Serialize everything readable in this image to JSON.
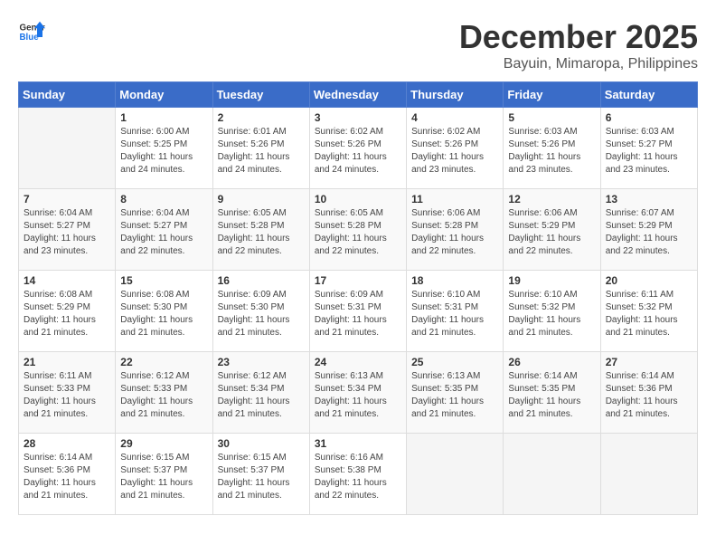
{
  "header": {
    "logo_general": "General",
    "logo_blue": "Blue",
    "month_year": "December 2025",
    "location": "Bayuin, Mimaropa, Philippines"
  },
  "weekdays": [
    "Sunday",
    "Monday",
    "Tuesday",
    "Wednesday",
    "Thursday",
    "Friday",
    "Saturday"
  ],
  "weeks": [
    [
      {
        "day": "",
        "sunrise": "",
        "sunset": "",
        "daylight": ""
      },
      {
        "day": "1",
        "sunrise": "Sunrise: 6:00 AM",
        "sunset": "Sunset: 5:25 PM",
        "daylight": "Daylight: 11 hours and 24 minutes."
      },
      {
        "day": "2",
        "sunrise": "Sunrise: 6:01 AM",
        "sunset": "Sunset: 5:26 PM",
        "daylight": "Daylight: 11 hours and 24 minutes."
      },
      {
        "day": "3",
        "sunrise": "Sunrise: 6:02 AM",
        "sunset": "Sunset: 5:26 PM",
        "daylight": "Daylight: 11 hours and 24 minutes."
      },
      {
        "day": "4",
        "sunrise": "Sunrise: 6:02 AM",
        "sunset": "Sunset: 5:26 PM",
        "daylight": "Daylight: 11 hours and 23 minutes."
      },
      {
        "day": "5",
        "sunrise": "Sunrise: 6:03 AM",
        "sunset": "Sunset: 5:26 PM",
        "daylight": "Daylight: 11 hours and 23 minutes."
      },
      {
        "day": "6",
        "sunrise": "Sunrise: 6:03 AM",
        "sunset": "Sunset: 5:27 PM",
        "daylight": "Daylight: 11 hours and 23 minutes."
      }
    ],
    [
      {
        "day": "7",
        "sunrise": "Sunrise: 6:04 AM",
        "sunset": "Sunset: 5:27 PM",
        "daylight": "Daylight: 11 hours and 23 minutes."
      },
      {
        "day": "8",
        "sunrise": "Sunrise: 6:04 AM",
        "sunset": "Sunset: 5:27 PM",
        "daylight": "Daylight: 11 hours and 22 minutes."
      },
      {
        "day": "9",
        "sunrise": "Sunrise: 6:05 AM",
        "sunset": "Sunset: 5:28 PM",
        "daylight": "Daylight: 11 hours and 22 minutes."
      },
      {
        "day": "10",
        "sunrise": "Sunrise: 6:05 AM",
        "sunset": "Sunset: 5:28 PM",
        "daylight": "Daylight: 11 hours and 22 minutes."
      },
      {
        "day": "11",
        "sunrise": "Sunrise: 6:06 AM",
        "sunset": "Sunset: 5:28 PM",
        "daylight": "Daylight: 11 hours and 22 minutes."
      },
      {
        "day": "12",
        "sunrise": "Sunrise: 6:06 AM",
        "sunset": "Sunset: 5:29 PM",
        "daylight": "Daylight: 11 hours and 22 minutes."
      },
      {
        "day": "13",
        "sunrise": "Sunrise: 6:07 AM",
        "sunset": "Sunset: 5:29 PM",
        "daylight": "Daylight: 11 hours and 22 minutes."
      }
    ],
    [
      {
        "day": "14",
        "sunrise": "Sunrise: 6:08 AM",
        "sunset": "Sunset: 5:29 PM",
        "daylight": "Daylight: 11 hours and 21 minutes."
      },
      {
        "day": "15",
        "sunrise": "Sunrise: 6:08 AM",
        "sunset": "Sunset: 5:30 PM",
        "daylight": "Daylight: 11 hours and 21 minutes."
      },
      {
        "day": "16",
        "sunrise": "Sunrise: 6:09 AM",
        "sunset": "Sunset: 5:30 PM",
        "daylight": "Daylight: 11 hours and 21 minutes."
      },
      {
        "day": "17",
        "sunrise": "Sunrise: 6:09 AM",
        "sunset": "Sunset: 5:31 PM",
        "daylight": "Daylight: 11 hours and 21 minutes."
      },
      {
        "day": "18",
        "sunrise": "Sunrise: 6:10 AM",
        "sunset": "Sunset: 5:31 PM",
        "daylight": "Daylight: 11 hours and 21 minutes."
      },
      {
        "day": "19",
        "sunrise": "Sunrise: 6:10 AM",
        "sunset": "Sunset: 5:32 PM",
        "daylight": "Daylight: 11 hours and 21 minutes."
      },
      {
        "day": "20",
        "sunrise": "Sunrise: 6:11 AM",
        "sunset": "Sunset: 5:32 PM",
        "daylight": "Daylight: 11 hours and 21 minutes."
      }
    ],
    [
      {
        "day": "21",
        "sunrise": "Sunrise: 6:11 AM",
        "sunset": "Sunset: 5:33 PM",
        "daylight": "Daylight: 11 hours and 21 minutes."
      },
      {
        "day": "22",
        "sunrise": "Sunrise: 6:12 AM",
        "sunset": "Sunset: 5:33 PM",
        "daylight": "Daylight: 11 hours and 21 minutes."
      },
      {
        "day": "23",
        "sunrise": "Sunrise: 6:12 AM",
        "sunset": "Sunset: 5:34 PM",
        "daylight": "Daylight: 11 hours and 21 minutes."
      },
      {
        "day": "24",
        "sunrise": "Sunrise: 6:13 AM",
        "sunset": "Sunset: 5:34 PM",
        "daylight": "Daylight: 11 hours and 21 minutes."
      },
      {
        "day": "25",
        "sunrise": "Sunrise: 6:13 AM",
        "sunset": "Sunset: 5:35 PM",
        "daylight": "Daylight: 11 hours and 21 minutes."
      },
      {
        "day": "26",
        "sunrise": "Sunrise: 6:14 AM",
        "sunset": "Sunset: 5:35 PM",
        "daylight": "Daylight: 11 hours and 21 minutes."
      },
      {
        "day": "27",
        "sunrise": "Sunrise: 6:14 AM",
        "sunset": "Sunset: 5:36 PM",
        "daylight": "Daylight: 11 hours and 21 minutes."
      }
    ],
    [
      {
        "day": "28",
        "sunrise": "Sunrise: 6:14 AM",
        "sunset": "Sunset: 5:36 PM",
        "daylight": "Daylight: 11 hours and 21 minutes."
      },
      {
        "day": "29",
        "sunrise": "Sunrise: 6:15 AM",
        "sunset": "Sunset: 5:37 PM",
        "daylight": "Daylight: 11 hours and 21 minutes."
      },
      {
        "day": "30",
        "sunrise": "Sunrise: 6:15 AM",
        "sunset": "Sunset: 5:37 PM",
        "daylight": "Daylight: 11 hours and 21 minutes."
      },
      {
        "day": "31",
        "sunrise": "Sunrise: 6:16 AM",
        "sunset": "Sunset: 5:38 PM",
        "daylight": "Daylight: 11 hours and 22 minutes."
      },
      {
        "day": "",
        "sunrise": "",
        "sunset": "",
        "daylight": ""
      },
      {
        "day": "",
        "sunrise": "",
        "sunset": "",
        "daylight": ""
      },
      {
        "day": "",
        "sunrise": "",
        "sunset": "",
        "daylight": ""
      }
    ]
  ]
}
